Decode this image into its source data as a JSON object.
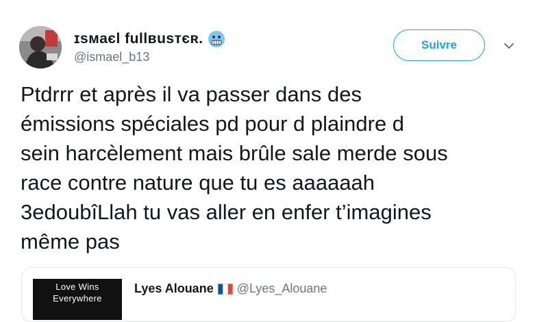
{
  "header": {
    "display_name": "ɪsмaєl fullвusтєʀ.",
    "handle": "@ismael_b13",
    "emoji": "freezing-face",
    "follow_label": "Suivre"
  },
  "tweet": {
    "lines": [
      "Ptdrrr et après il va passer dans des",
      "émissions spéciales pd pour d plaindre d",
      "sein harcèlement mais brûle sale merde sous",
      "race contre nature que tu es aaaaaah",
      "3edoubîLlah tu vas aller en enfer t’imagines",
      "même pas"
    ]
  },
  "quote": {
    "thumb_lines": [
      "Love Wins",
      "Everywhere"
    ],
    "name": "Lyes Alouane",
    "flag": "france-flag",
    "handle": "@Lyes_Alouane"
  },
  "colors": {
    "accent": "#1da1f2",
    "text": "#14171a",
    "muted": "#657786",
    "border": "#e1e8ed"
  }
}
